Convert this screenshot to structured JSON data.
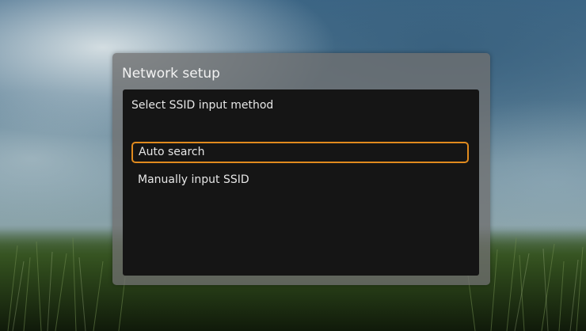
{
  "dialog": {
    "title": "Network setup",
    "prompt": "Select SSID input method",
    "options": [
      {
        "label": "Auto search",
        "selected": true
      },
      {
        "label": "Manually input SSID",
        "selected": false
      }
    ]
  },
  "colors": {
    "highlight": "#e08a1e",
    "panel": "#151515",
    "dialog_frame": "#707070"
  }
}
